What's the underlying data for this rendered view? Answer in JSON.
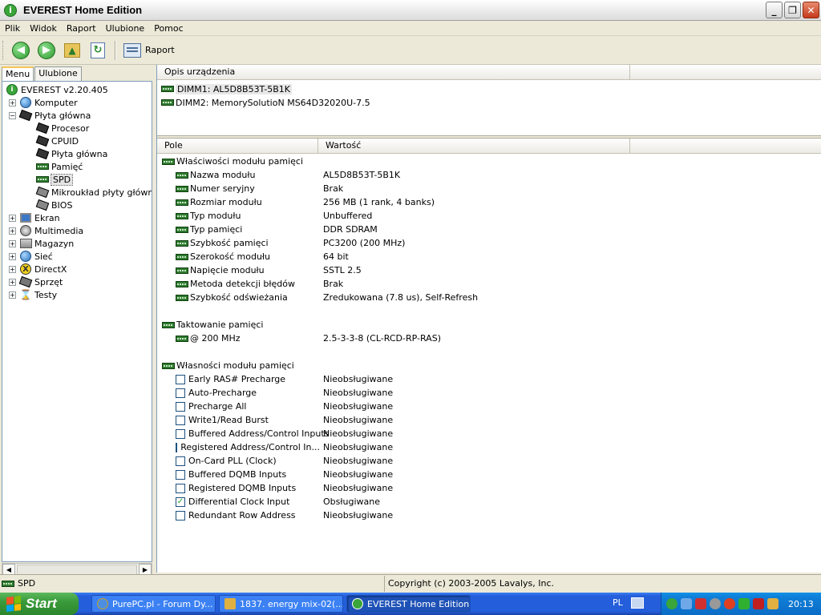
{
  "window": {
    "title": "EVEREST Home Edition"
  },
  "menu": [
    "Plik",
    "Widok",
    "Raport",
    "Ulubione",
    "Pomoc"
  ],
  "toolbar": {
    "report_label": "Raport"
  },
  "tabs": {
    "menu": "Menu",
    "favorites": "Ulubione"
  },
  "tree": {
    "root": "EVEREST v2.20.405",
    "items": [
      {
        "label": "Komputer"
      },
      {
        "label": "Płyta główna"
      },
      {
        "label": "Procesor"
      },
      {
        "label": "CPUID"
      },
      {
        "label": "Płyta główna"
      },
      {
        "label": "Pamięć"
      },
      {
        "label": "SPD"
      },
      {
        "label": "Mikroukład płyty głównej"
      },
      {
        "label": "BIOS"
      },
      {
        "label": "Ekran"
      },
      {
        "label": "Multimedia"
      },
      {
        "label": "Magazyn"
      },
      {
        "label": "Sieć"
      },
      {
        "label": "DirectX"
      },
      {
        "label": "Sprzęt"
      },
      {
        "label": "Testy"
      }
    ]
  },
  "device_panel": {
    "header": "Opis urządzenia",
    "devices": [
      "DIMM1: AL5D8B53T-5B1K",
      "DIMM2: MemorySolutioN MS64D32020U-7.5"
    ]
  },
  "details": {
    "col_field": "Pole",
    "col_value": "Wartość",
    "rows": [
      {
        "field": "Właściwości modułu pamięci",
        "value": ""
      },
      {
        "field": "Nazwa modułu",
        "value": "AL5D8B53T-5B1K"
      },
      {
        "field": "Numer seryjny",
        "value": "Brak"
      },
      {
        "field": "Rozmiar modułu",
        "value": "256 MB (1 rank, 4 banks)"
      },
      {
        "field": "Typ modułu",
        "value": "Unbuffered"
      },
      {
        "field": "Typ pamięci",
        "value": "DDR SDRAM"
      },
      {
        "field": "Szybkość pamięci",
        "value": "PC3200 (200 MHz)"
      },
      {
        "field": "Szerokość modułu",
        "value": "64 bit"
      },
      {
        "field": "Napięcie modułu",
        "value": "SSTL 2.5"
      },
      {
        "field": "Metoda detekcji błędów",
        "value": "Brak"
      },
      {
        "field": "Szybkość odświeżania",
        "value": "Zredukowana (7.8 us), Self-Refresh"
      },
      {
        "field": "Taktowanie pamięci",
        "value": ""
      },
      {
        "field": "@ 200 MHz",
        "value": "2.5-3-3-8  (CL-RCD-RP-RAS)"
      },
      {
        "field": "Własności modułu pamięci",
        "value": ""
      },
      {
        "field": "Early RAS# Precharge",
        "value": "Nieobsługiwane",
        "checked": false
      },
      {
        "field": "Auto-Precharge",
        "value": "Nieobsługiwane",
        "checked": false
      },
      {
        "field": "Precharge All",
        "value": "Nieobsługiwane",
        "checked": false
      },
      {
        "field": "Write1/Read Burst",
        "value": "Nieobsługiwane",
        "checked": false
      },
      {
        "field": "Buffered Address/Control Inputs",
        "value": "Nieobsługiwane",
        "checked": false
      },
      {
        "field": "Registered Address/Control In...",
        "value": "Nieobsługiwane",
        "checked": false
      },
      {
        "field": "On-Card PLL (Clock)",
        "value": "Nieobsługiwane",
        "checked": false
      },
      {
        "field": "Buffered DQMB Inputs",
        "value": "Nieobsługiwane",
        "checked": false
      },
      {
        "field": "Registered DQMB Inputs",
        "value": "Nieobsługiwane",
        "checked": false
      },
      {
        "field": "Differential Clock Input",
        "value": "Obsługiwane",
        "checked": true
      },
      {
        "field": "Redundant Row Address",
        "value": "Nieobsługiwane",
        "checked": false
      }
    ]
  },
  "status": {
    "left": "SPD",
    "right": "Copyright (c) 2003-2005 Lavalys, Inc."
  },
  "taskbar": {
    "start": "Start",
    "tasks": [
      "PurePC.pl - Forum Dy...",
      "1837. energy mix-02(...",
      "EVEREST Home Edition"
    ],
    "language": "PL",
    "clock": "20:13"
  }
}
